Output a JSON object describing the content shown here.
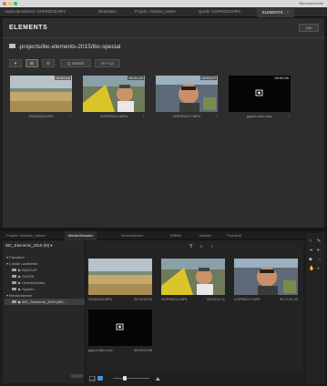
{
  "window": {
    "title": "/Benutzer/chris"
  },
  "tabs": [
    {
      "label": "Audioclip-Mischer: GOPR0018.MP4"
    },
    {
      "label": "Metadaten"
    },
    {
      "label": "Projekt: christian_heiner"
    },
    {
      "label": "Quelle: GOPR0018.MP4"
    },
    {
      "label": "ELEMENTS",
      "active": true,
      "close": "×"
    }
  ],
  "elements_panel": {
    "logo": "ELEMENTS",
    "top_button": "Edit",
    "path": ".projects/ibc-elements-2015/ibc-special",
    "toolbar": [
      "▼",
      "☰",
      "⊞",
      "Q. Search",
      "Hi + Lo"
    ],
    "thumbnails": [
      {
        "duration": "00:00:15",
        "caption": "20150318.MP4",
        "info": "i",
        "icon": "field-thumbnail"
      },
      {
        "duration": "00:41:22",
        "caption": "GOPR0014.MP4",
        "info": "i",
        "icon": "cyclist-thumbnail"
      },
      {
        "duration": "00:03:07",
        "caption": "GOPR0017.MP4",
        "info": "i",
        "icon": "selfie-thumbnail"
      },
      {
        "duration": "00:00:25",
        "caption": "gopro-intro.mov",
        "info": "i",
        "icon": "gopro-logo-thumbnail"
      }
    ]
  },
  "media_browser": {
    "tabs": [
      {
        "label": "Projekt: christian_heiner"
      },
      {
        "label": "Media-Browser",
        "active": true
      },
      {
        "label": "Informationen"
      },
      {
        "label": "Effekte"
      },
      {
        "label": "Marken"
      },
      {
        "label": "Protokoll"
      }
    ],
    "breadcrumb": "IBC_Elements_2015 (M) ▾",
    "tree": [
      {
        "label": "▾ Favoriten",
        "indent": 0
      },
      {
        "label": "▾ Lokale Laufwerke",
        "indent": 0
      },
      {
        "label": "▶ BACKUP",
        "indent": 1,
        "folder": true
      },
      {
        "label": "▶ DATEN",
        "indent": 1,
        "folder": true
      },
      {
        "label": "▶ Hintrisfechase",
        "indent": 1,
        "folder": true
      },
      {
        "label": "▶ System",
        "indent": 1,
        "folder": true
      },
      {
        "label": "▾ Netzlaufwerke",
        "indent": 0
      },
      {
        "label": "▶ IBC_Elements_2015 (IBC...",
        "indent": 1,
        "folder": true,
        "selected": true
      }
    ],
    "icons": [
      "∇",
      "⌕",
      "♀"
    ],
    "thumbnails": [
      {
        "caption": "20150318.MP4",
        "duration": "00:03:32:13"
      },
      {
        "caption": "GOPR0014.MP4",
        "duration": "00:04:21:11"
      },
      {
        "caption": "GOPR0017.MP4",
        "duration": "00:17:51:29"
      },
      {
        "caption": "gopro-intro.mov",
        "duration": "00:00:02:08"
      }
    ]
  },
  "colors": {
    "accent": "#4a90d9",
    "panel": "#2d2d2d"
  }
}
